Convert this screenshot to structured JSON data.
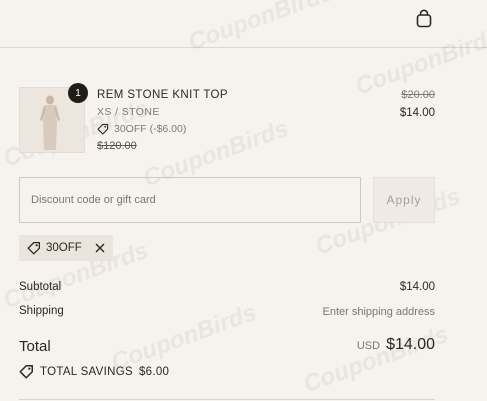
{
  "header": {
    "bag_icon": "shopping-bag-icon"
  },
  "watermark": {
    "text": "CouponBirds"
  },
  "line_item": {
    "quantity": "1",
    "title": "REM STONE KNIT TOP",
    "variant": "XS / STONE",
    "discount": "30OFF (-$6.00)",
    "original_price": "$120.00",
    "price_before": "$20.00",
    "price_after": "$14.00",
    "thumbnail_icon": "product-image"
  },
  "discount_form": {
    "placeholder": "Discount code or gift card",
    "apply_label": "Apply"
  },
  "applied_code": {
    "label": "30OFF",
    "remove_icon": "close-icon"
  },
  "summary": {
    "subtotal_label": "Subtotal",
    "subtotal_value": "$14.00",
    "shipping_label": "Shipping",
    "shipping_value": "Enter shipping address",
    "total_label": "Total",
    "total_currency": "USD",
    "total_value": "$14.00",
    "savings_label": "TOTAL SAVINGS",
    "savings_value": "$6.00"
  },
  "colors": {
    "background": "#f6f3ef",
    "text": "#2b2725",
    "muted": "#807970",
    "chip": "#ebe4dc",
    "badge": "#1f1c1a"
  }
}
